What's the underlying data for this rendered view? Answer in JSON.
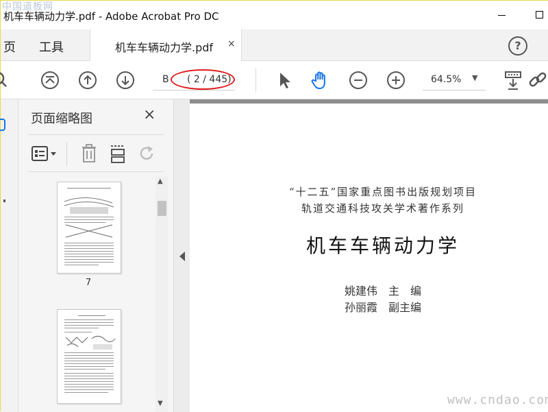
{
  "window": {
    "title": "机车车辆动力学.pdf - Adobe Acrobat Pro DC",
    "watermark": "中国道板网"
  },
  "menubar": {
    "home_tab": "页",
    "tools_tab": "工具",
    "doc_tab_label": "机车车辆动力学.pdf",
    "doc_tab_close": "×",
    "help": "?"
  },
  "toolbar": {
    "page_current": "B",
    "page_count": "( 2 / 445)",
    "zoom": "64.5%",
    "icons": [
      "search-icon",
      "first-page-icon",
      "prev-page-icon",
      "next-page-icon",
      "select-arrow-icon",
      "hand-icon",
      "zoom-out-icon",
      "zoom-in-icon",
      "zoom-dropdown",
      "keyboard-download-icon",
      "link-icon"
    ]
  },
  "panel": {
    "title": "页面缩略图",
    "close": "×",
    "thumb_labels": [
      "7"
    ]
  },
  "document": {
    "line1": "“十二五”国家重点图书出版规划项目",
    "line2": "轨道交通科技攻关学术著作系列",
    "title": "机车车辆动力学",
    "editor1": "姚建伟　主　编",
    "editor2": "孙丽霞　副主编",
    "watermark": "www.cndao.com"
  },
  "colors": {
    "accent_blue": "#1473e6",
    "annotation_red": "#e01919",
    "doc_border": "#8d8d8d"
  }
}
